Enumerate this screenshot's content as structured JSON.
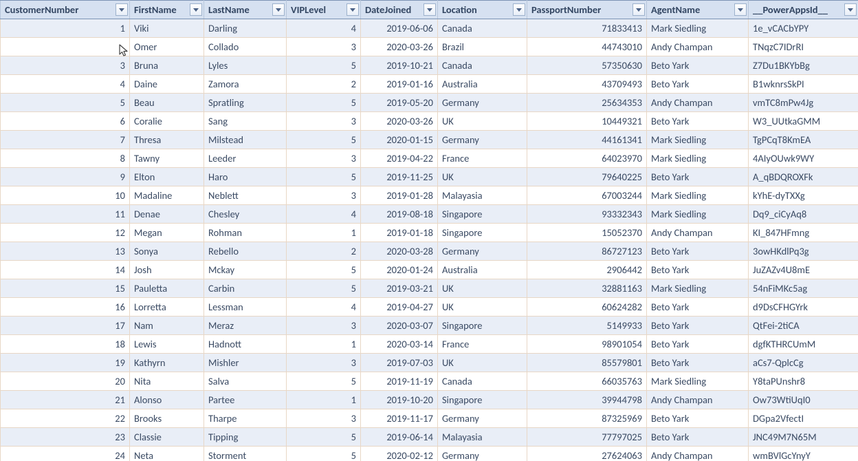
{
  "columns": [
    {
      "key": "CustomerNumber",
      "header": "CustomerNumber",
      "align": "right"
    },
    {
      "key": "FirstName",
      "header": "FirstName",
      "align": "left"
    },
    {
      "key": "LastName",
      "header": "LastName",
      "align": "left"
    },
    {
      "key": "VIPLevel",
      "header": "VIPLevel",
      "align": "right"
    },
    {
      "key": "DateJoined",
      "header": "DateJoined",
      "align": "right"
    },
    {
      "key": "Location",
      "header": "Location",
      "align": "left"
    },
    {
      "key": "PassportNumber",
      "header": "PassportNumber",
      "align": "right"
    },
    {
      "key": "AgentName",
      "header": "AgentName",
      "align": "left"
    },
    {
      "key": "PowerAppsId",
      "header": "__PowerAppsId__",
      "align": "left"
    }
  ],
  "rows": [
    {
      "CustomerNumber": 1,
      "FirstName": "Viki",
      "LastName": "Darling",
      "VIPLevel": 4,
      "DateJoined": "2019-06-06",
      "Location": "Canada",
      "PassportNumber": 71833413,
      "AgentName": "Mark Siedling",
      "PowerAppsId": "1e_vCACbYPY"
    },
    {
      "CustomerNumber": "",
      "FirstName": "Omer",
      "LastName": "Collado",
      "VIPLevel": 3,
      "DateJoined": "2020-03-26",
      "Location": "Brazil",
      "PassportNumber": 44743010,
      "AgentName": "Andy Champan",
      "PowerAppsId": "TNqzC7IDrRI"
    },
    {
      "CustomerNumber": 3,
      "FirstName": "Bruna",
      "LastName": "Lyles",
      "VIPLevel": 5,
      "DateJoined": "2019-10-21",
      "Location": "Canada",
      "PassportNumber": 57350630,
      "AgentName": "Beto Yark",
      "PowerAppsId": "Z7Du1BKYbBg"
    },
    {
      "CustomerNumber": 4,
      "FirstName": "Daine",
      "LastName": "Zamora",
      "VIPLevel": 2,
      "DateJoined": "2019-01-16",
      "Location": "Australia",
      "PassportNumber": 43709493,
      "AgentName": "Beto Yark",
      "PowerAppsId": "B1wknrsSkPI"
    },
    {
      "CustomerNumber": 5,
      "FirstName": "Beau",
      "LastName": "Spratling",
      "VIPLevel": 5,
      "DateJoined": "2019-05-20",
      "Location": "Germany",
      "PassportNumber": 25634353,
      "AgentName": "Andy Champan",
      "PowerAppsId": "vmTC8mPw4Jg"
    },
    {
      "CustomerNumber": 6,
      "FirstName": "Coralie",
      "LastName": "Sang",
      "VIPLevel": 3,
      "DateJoined": "2020-03-26",
      "Location": "UK",
      "PassportNumber": 10449321,
      "AgentName": "Beto Yark",
      "PowerAppsId": "W3_UUtkaGMM"
    },
    {
      "CustomerNumber": 7,
      "FirstName": "Thresa",
      "LastName": "Milstead",
      "VIPLevel": 5,
      "DateJoined": "2020-01-15",
      "Location": "Germany",
      "PassportNumber": 44161341,
      "AgentName": "Mark Siedling",
      "PowerAppsId": "TgPCqT8KmEA"
    },
    {
      "CustomerNumber": 8,
      "FirstName": "Tawny",
      "LastName": "Leeder",
      "VIPLevel": 3,
      "DateJoined": "2019-04-22",
      "Location": "France",
      "PassportNumber": 64023970,
      "AgentName": "Mark Siedling",
      "PowerAppsId": "4AIyOUwk9WY"
    },
    {
      "CustomerNumber": 9,
      "FirstName": "Elton",
      "LastName": "Haro",
      "VIPLevel": 5,
      "DateJoined": "2019-11-25",
      "Location": "UK",
      "PassportNumber": 79640225,
      "AgentName": "Beto Yark",
      "PowerAppsId": "A_qBDQROXFk"
    },
    {
      "CustomerNumber": 10,
      "FirstName": "Madaline",
      "LastName": "Neblett",
      "VIPLevel": 3,
      "DateJoined": "2019-01-28",
      "Location": "Malayasia",
      "PassportNumber": 67003244,
      "AgentName": "Mark Siedling",
      "PowerAppsId": "kYhE-dyTXXg"
    },
    {
      "CustomerNumber": 11,
      "FirstName": "Denae",
      "LastName": "Chesley",
      "VIPLevel": 4,
      "DateJoined": "2019-08-18",
      "Location": "Singapore",
      "PassportNumber": 93332343,
      "AgentName": "Mark Siedling",
      "PowerAppsId": "Dq9_ciCyAq8"
    },
    {
      "CustomerNumber": 12,
      "FirstName": "Megan",
      "LastName": "Rohman",
      "VIPLevel": 1,
      "DateJoined": "2019-01-18",
      "Location": "Singapore",
      "PassportNumber": 15052370,
      "AgentName": "Andy Champan",
      "PowerAppsId": "KI_847HFmng"
    },
    {
      "CustomerNumber": 13,
      "FirstName": "Sonya",
      "LastName": "Rebello",
      "VIPLevel": 2,
      "DateJoined": "2020-03-28",
      "Location": "Germany",
      "PassportNumber": 86727123,
      "AgentName": "Beto Yark",
      "PowerAppsId": "3owHKdlPq3g"
    },
    {
      "CustomerNumber": 14,
      "FirstName": "Josh",
      "LastName": "Mckay",
      "VIPLevel": 5,
      "DateJoined": "2020-01-24",
      "Location": "Australia",
      "PassportNumber": 2906442,
      "AgentName": "Beto Yark",
      "PowerAppsId": "JuZAZv4U8mE"
    },
    {
      "CustomerNumber": 15,
      "FirstName": "Pauletta",
      "LastName": "Carbin",
      "VIPLevel": 5,
      "DateJoined": "2019-03-21",
      "Location": "UK",
      "PassportNumber": 32881163,
      "AgentName": "Mark Siedling",
      "PowerAppsId": "54nFiMKc5ag"
    },
    {
      "CustomerNumber": 16,
      "FirstName": "Lorretta",
      "LastName": "Lessman",
      "VIPLevel": 4,
      "DateJoined": "2019-04-27",
      "Location": "UK",
      "PassportNumber": 60624282,
      "AgentName": "Beto Yark",
      "PowerAppsId": "d9DsCFHGYrk"
    },
    {
      "CustomerNumber": 17,
      "FirstName": "Nam",
      "LastName": "Meraz",
      "VIPLevel": 3,
      "DateJoined": "2020-03-07",
      "Location": "Singapore",
      "PassportNumber": 5149933,
      "AgentName": "Beto Yark",
      "PowerAppsId": "QtFei-2tiCA"
    },
    {
      "CustomerNumber": 18,
      "FirstName": "Lewis",
      "LastName": "Hadnott",
      "VIPLevel": 1,
      "DateJoined": "2020-03-14",
      "Location": "France",
      "PassportNumber": 98901054,
      "AgentName": "Beto Yark",
      "PowerAppsId": "dgfKTHRCUmM"
    },
    {
      "CustomerNumber": 19,
      "FirstName": "Kathyrn",
      "LastName": "Mishler",
      "VIPLevel": 3,
      "DateJoined": "2019-07-03",
      "Location": "UK",
      "PassportNumber": 85579801,
      "AgentName": "Beto Yark",
      "PowerAppsId": "aCs7-QplcCg"
    },
    {
      "CustomerNumber": 20,
      "FirstName": "Nita",
      "LastName": "Salva",
      "VIPLevel": 5,
      "DateJoined": "2019-11-19",
      "Location": "Canada",
      "PassportNumber": 66035763,
      "AgentName": "Mark Siedling",
      "PowerAppsId": "Y8taPUnshr8"
    },
    {
      "CustomerNumber": 21,
      "FirstName": "Alonso",
      "LastName": "Partee",
      "VIPLevel": 1,
      "DateJoined": "2019-10-20",
      "Location": "Singapore",
      "PassportNumber": 39944798,
      "AgentName": "Andy Champan",
      "PowerAppsId": "Ow73WtiUqI0"
    },
    {
      "CustomerNumber": 22,
      "FirstName": "Brooks",
      "LastName": "Tharpe",
      "VIPLevel": 3,
      "DateJoined": "2019-11-17",
      "Location": "Germany",
      "PassportNumber": 87325969,
      "AgentName": "Beto Yark",
      "PowerAppsId": "DGpa2VfectI"
    },
    {
      "CustomerNumber": 23,
      "FirstName": "Classie",
      "LastName": "Tipping",
      "VIPLevel": 5,
      "DateJoined": "2019-06-14",
      "Location": "Malayasia",
      "PassportNumber": 77797025,
      "AgentName": "Beto Yark",
      "PowerAppsId": "JNC49M7N65M"
    },
    {
      "CustomerNumber": 24,
      "FirstName": "Neta",
      "LastName": "Storment",
      "VIPLevel": 5,
      "DateJoined": "2020-02-12",
      "Location": "Germany",
      "PassportNumber": 27624063,
      "AgentName": "Andy Champan",
      "PowerAppsId": "wmBVlGcYnyY"
    }
  ]
}
